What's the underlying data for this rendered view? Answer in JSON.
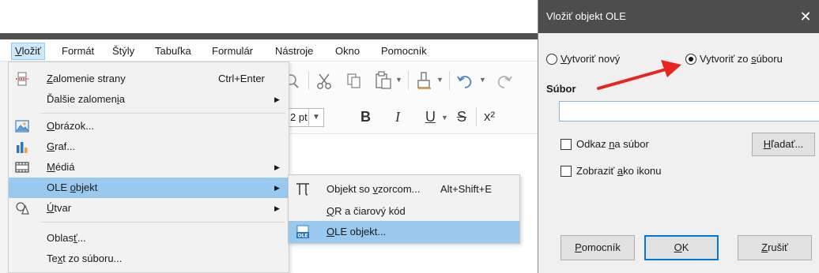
{
  "menubar": {
    "items": [
      "Vložiť",
      "Formát",
      "Štýly",
      "Tabuľka",
      "Formulár",
      "Nástroje",
      "Okno",
      "Pomocník"
    ]
  },
  "toolbar": {
    "font_size": "2 pt",
    "bold": "B",
    "italic": "I",
    "underline": "U",
    "strike": "S",
    "superscript": "x²"
  },
  "insert_menu": {
    "items": [
      {
        "label": "Zalomenie strany",
        "shortcut": "Ctrl+Enter",
        "icon": "page-break-icon"
      },
      {
        "label": "Ďalšie zalomenia",
        "icon": ""
      },
      {
        "label": "Obrázok...",
        "icon": "image-icon"
      },
      {
        "label": "Graf...",
        "icon": "chart-icon"
      },
      {
        "label": "Médiá",
        "icon": "media-icon"
      },
      {
        "label": "OLE objekt",
        "icon": ""
      },
      {
        "label": "Útvar",
        "icon": "shapes-icon"
      },
      {
        "label": "Oblasť...",
        "icon": ""
      },
      {
        "label": "Text zo súboru...",
        "icon": ""
      }
    ]
  },
  "ole_submenu": {
    "items": [
      {
        "label": "Objekt so vzorcom...",
        "shortcut": "Alt+Shift+E",
        "icon": "formula-icon"
      },
      {
        "label": "QR a čiarový kód",
        "icon": ""
      },
      {
        "label": "OLE objekt...",
        "icon": "ole-object-icon"
      }
    ]
  },
  "dialog": {
    "title": "Vložiť objekt OLE",
    "radio_new": "Vytvoriť nový",
    "radio_from_file": "Vytvoriť zo súboru",
    "file_section": "Súbor",
    "file_value": "",
    "link_to_file": "Odkaz na súbor",
    "browse": "Hľadať...",
    "display_as_icon": "Zobraziť ako ikonu",
    "help": "Pomocník",
    "ok": "OK",
    "cancel": "Zrušiť",
    "selected_option": "from_file"
  },
  "colors": {
    "highlight": "#99c9ef",
    "annotation_arrow": "#e8241c",
    "dialog_titlebar": "#4d4d4d"
  }
}
